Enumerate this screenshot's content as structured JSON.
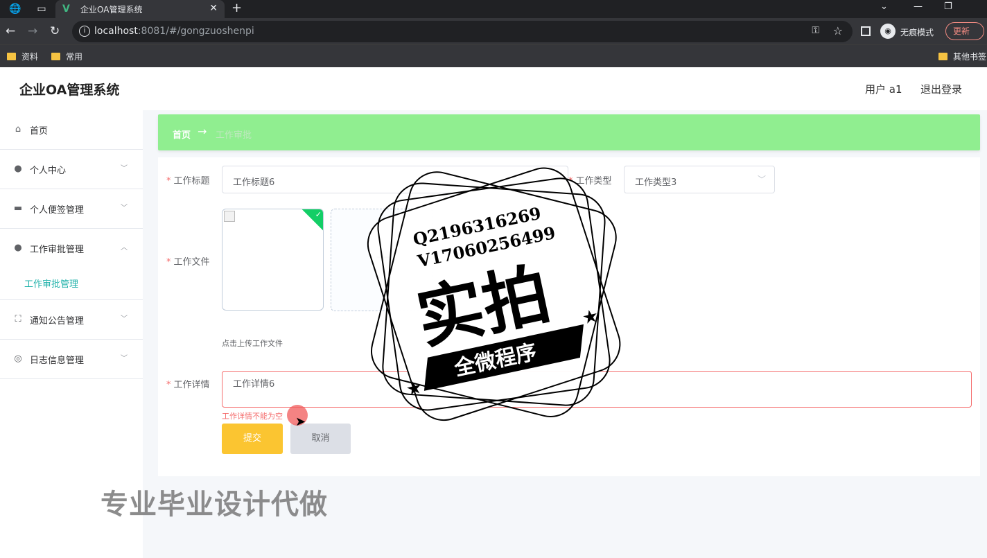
{
  "browser": {
    "tab_title": "企业OA管理系统",
    "url_host": "localhost",
    "url_rest": ":8081/#/gongzuoshenpi",
    "incognito_label": "无痕模式",
    "update_label": "更新",
    "bookmarks": [
      "资料",
      "常用"
    ],
    "other_bookmarks": "其他书签"
  },
  "app": {
    "title": "企业OA管理系统",
    "user_label": "用户 a1",
    "logout_label": "退出登录"
  },
  "sidebar": {
    "items": [
      {
        "label": "首页",
        "icon": "home-icon"
      },
      {
        "label": "个人中心",
        "icon": "user-icon"
      },
      {
        "label": "个人便签管理",
        "icon": "briefcase-icon"
      },
      {
        "label": "工作审批管理",
        "icon": "user-icon",
        "expanded": true
      },
      {
        "label": "通知公告管理",
        "icon": "fullscreen-icon"
      },
      {
        "label": "日志信息管理",
        "icon": "compass-icon"
      }
    ],
    "sub_item": "工作审批管理"
  },
  "breadcrumb": {
    "home": "首页",
    "separator": "→",
    "current": "工作审批"
  },
  "form": {
    "title_label": "工作标题",
    "title_value": "工作标题6",
    "type_label": "工作类型",
    "type_value": "工作类型3",
    "file_label": "工作文件",
    "upload_tip": "点击上传工作文件",
    "detail_label": "工作详情",
    "detail_value": "工作详情6",
    "detail_error": "工作详情不能为空",
    "submit_label": "提交",
    "cancel_label": "取消"
  },
  "overlay": {
    "stamp_line1": "Q2196316269",
    "stamp_line2": "V17060256499",
    "stamp_big": "实拍",
    "stamp_banner": "全微程序",
    "bottom_text": "专业毕业设计代做"
  },
  "colors": {
    "accent": "#90ee90",
    "active_menu": "#20b2aa",
    "submit": "#fbc531",
    "error": "#f56c6c"
  }
}
